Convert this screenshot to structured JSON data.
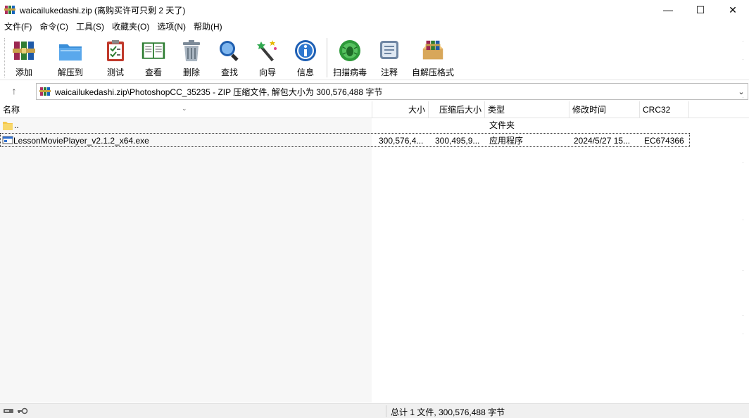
{
  "window": {
    "title": "waicailukedashi.zip (离购买许可只剩 2 天了)",
    "minimize": "—",
    "maximize": "☐",
    "close": "✕"
  },
  "menu": [
    "文件(F)",
    "命令(C)",
    "工具(S)",
    "收藏夹(O)",
    "选项(N)",
    "帮助(H)"
  ],
  "toolbar": {
    "add": "添加",
    "extract": "解压到",
    "test": "测试",
    "view": "查看",
    "delete": "删除",
    "find": "查找",
    "wizard": "向导",
    "info": "信息",
    "scan": "扫描病毒",
    "comment": "注释",
    "sfx": "自解压格式"
  },
  "address": {
    "up": "↑",
    "path": "waicailukedashi.zip\\PhotoshopCC_35235 - ZIP 压缩文件, 解包大小为 300,576,488 字节",
    "dropdown": "⌄"
  },
  "columns": {
    "name": "名称",
    "size": "大小",
    "packed": "压缩后大小",
    "type": "类型",
    "modified": "修改时间",
    "crc": "CRC32"
  },
  "rows": [
    {
      "name": "..",
      "size": "",
      "packed": "",
      "type": "文件夹",
      "modified": "",
      "crc": ""
    },
    {
      "name": "LessonMoviePlayer_v2.1.2_x64.exe",
      "size": "300,576,4...",
      "packed": "300,495,9...",
      "type": "应用程序",
      "modified": "2024/5/27 15...",
      "crc": "EC674366"
    }
  ],
  "status": {
    "summary": "总计 1 文件, 300,576,488 字节"
  },
  "colors": {
    "accent": "#1e6bd6",
    "folder": "#f5c84c",
    "selection_border": "#333333"
  }
}
